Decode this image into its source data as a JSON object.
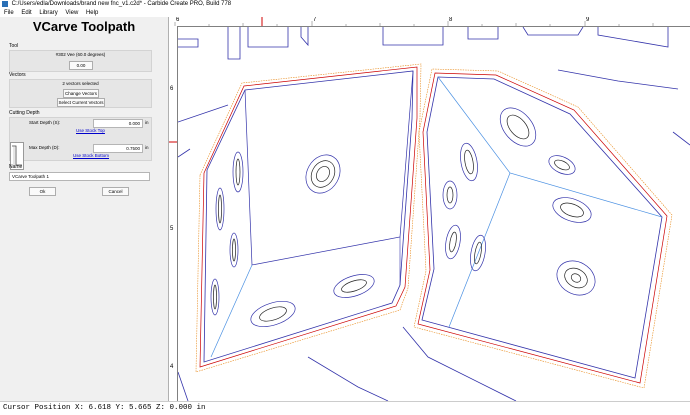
{
  "window": {
    "title": "C:/Users/edla/Downloads/brand new fnc_v1.c2d* - Carbide Create PRO, Build 778"
  },
  "menu": {
    "items": [
      "File",
      "Edit",
      "Library",
      "View",
      "Help"
    ]
  },
  "panel": {
    "title": "VCarve Toolpath",
    "tool": {
      "label": "Tool",
      "name": "#302 Vee (60.0 degrees)",
      "value": "0.00"
    },
    "vectors": {
      "label": "Vectors",
      "count": "2 vectors selected",
      "change_btn": "Change Vectors",
      "select_btn": "Select Current Vectors"
    },
    "cutting_depth": {
      "label": "Cutting Depth",
      "start_label": "Start Depth (S):",
      "start_value": "0.000",
      "start_unit": "in",
      "start_link": "Use Stock Top",
      "max_label": "Max Depth (D):",
      "max_value": "0.7500",
      "max_unit": "in",
      "max_link": "Use Stock Bottom"
    },
    "name": {
      "label": "Name",
      "value": "VCarve Toolpath 1"
    },
    "ok": "Ok",
    "cancel": "Cancel"
  },
  "ruler": {
    "top": [
      "6",
      "7",
      "8",
      "9"
    ],
    "left": [
      "6",
      "5",
      "4"
    ]
  },
  "status": {
    "cursor": "Cursor Position X: 6.618 Y: 5.665 Z: 0.000 in"
  },
  "colors": {
    "outline": "#3333aa",
    "offset_red": "#cc0000",
    "offset_orange": "#e88a1a",
    "toolpath": "#222222",
    "accent": "#d00000"
  }
}
